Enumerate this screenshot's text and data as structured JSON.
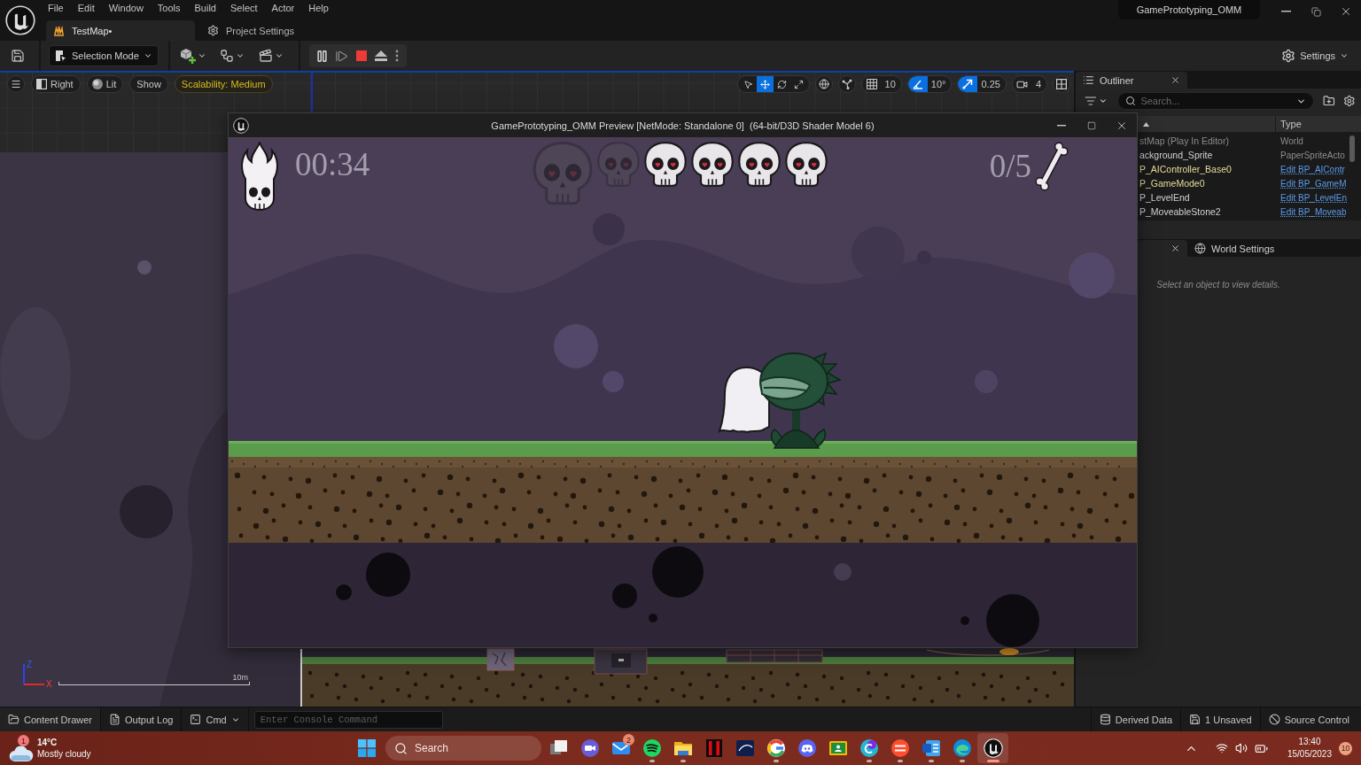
{
  "editor": {
    "menu": [
      "File",
      "Edit",
      "Window",
      "Tools",
      "Build",
      "Select",
      "Actor",
      "Help"
    ],
    "tabs": [
      {
        "kind": "level",
        "label": "TestMap•",
        "selected": true
      },
      {
        "kind": "settings",
        "label": "Project Settings",
        "selected": false
      }
    ],
    "project_name": "GamePrototyping_OMM"
  },
  "toolbar": {
    "selection_mode": "Selection Mode",
    "settings": "Settings"
  },
  "viewport": {
    "buttons": [
      {
        "kind": "view",
        "label": "Right"
      },
      {
        "kind": "lit",
        "label": "Lit"
      },
      {
        "kind": "show",
        "label": "Show"
      },
      {
        "kind": "scalability",
        "label": "Scalability: Medium"
      }
    ],
    "transform_tools": [
      {
        "kind": "select",
        "selected": false
      },
      {
        "kind": "translate",
        "selected": true
      },
      {
        "kind": "rotate",
        "selected": false
      },
      {
        "kind": "scale",
        "selected": false
      }
    ],
    "snaps": [
      {
        "kind": "grid",
        "value": "10",
        "on": false
      },
      {
        "kind": "rotation",
        "value": "10°",
        "on": true
      },
      {
        "kind": "scale",
        "value": "0.25",
        "on": true
      }
    ],
    "camera_speed": "4",
    "axis_labels": {
      "z": "Z",
      "x": "X"
    },
    "scale_label": "10m"
  },
  "game_window": {
    "title": "GamePrototyping_OMM Preview [NetMode: Standalone 0]  (64-bit/D3D Shader Model 6)",
    "hud": {
      "timer": "00:34",
      "lives": [
        {
          "lost": true
        },
        {
          "lost": true
        },
        {
          "lost": false
        },
        {
          "lost": false
        },
        {
          "lost": false
        },
        {
          "lost": false
        }
      ],
      "bones": "0/5"
    }
  },
  "outliner": {
    "title": "Outliner",
    "search": {
      "placeholder": "Search..."
    },
    "type_column": "Type",
    "rows": [
      {
        "label": "stMap (Play In Editor)",
        "color": "#8d8d8d",
        "type": "World",
        "link": false
      },
      {
        "label": "ackground_Sprite",
        "color": "#d2d2d2",
        "type": "PaperSpriteActo",
        "link": false
      },
      {
        "label": "P_AIController_Base0",
        "color": "#e6dc9a",
        "type": "Edit BP_AIContr",
        "link": true
      },
      {
        "label": "P_GameMode0",
        "color": "#e6dc9a",
        "type": "Edit BP_GameM",
        "link": true
      },
      {
        "label": "P_LevelEnd",
        "color": "#d2d2d2",
        "type": "Edit BP_LevelEn",
        "link": true
      },
      {
        "label": "P_MoveableStone2",
        "color": "#d2d2d2",
        "type": "Edit BP_Moveab",
        "link": true
      }
    ]
  },
  "details": {
    "tab": "World Settings",
    "message": "Select an object to view details."
  },
  "status_bar": {
    "left": [
      {
        "kind": "content-drawer",
        "label": "Content Drawer"
      },
      {
        "kind": "output-log",
        "label": "Output Log"
      },
      {
        "kind": "cmd",
        "label": "Cmd"
      }
    ],
    "console": {
      "placeholder": "Enter Console Command"
    },
    "right": [
      {
        "kind": "derived-data",
        "label": "Derived Data"
      },
      {
        "kind": "unsaved",
        "label": "1 Unsaved"
      },
      {
        "kind": "source-control",
        "label": "Source Control"
      }
    ]
  },
  "taskbar": {
    "weather": {
      "badge": "1",
      "temperature": "14°C",
      "condition": "Mostly cloudy"
    },
    "search": {
      "placeholder": "Search"
    },
    "apps": [
      {
        "kind": "task-view",
        "running": false,
        "selected": false
      },
      {
        "kind": "meet",
        "running": false,
        "selected": false
      },
      {
        "kind": "mail",
        "running": false,
        "selected": false,
        "badge": "2"
      },
      {
        "kind": "spotify",
        "running": true,
        "selected": false
      },
      {
        "kind": "files",
        "running": true,
        "selected": false
      },
      {
        "kind": "netflix",
        "running": false,
        "selected": false
      },
      {
        "kind": "disney",
        "running": false,
        "selected": false
      },
      {
        "kind": "chrome",
        "running": true,
        "selected": false
      },
      {
        "kind": "discord",
        "running": false,
        "selected": false
      },
      {
        "kind": "classroom",
        "running": false,
        "selected": false
      },
      {
        "kind": "canva",
        "running": true,
        "selected": false
      },
      {
        "kind": "ea",
        "running": true,
        "selected": false
      },
      {
        "kind": "word",
        "running": true,
        "selected": false
      },
      {
        "kind": "edge",
        "running": true,
        "selected": false
      },
      {
        "kind": "unreal",
        "running": true,
        "selected": true
      }
    ],
    "clock": {
      "time": "13:40",
      "date": "15/05/2023"
    },
    "notifications": "10"
  }
}
